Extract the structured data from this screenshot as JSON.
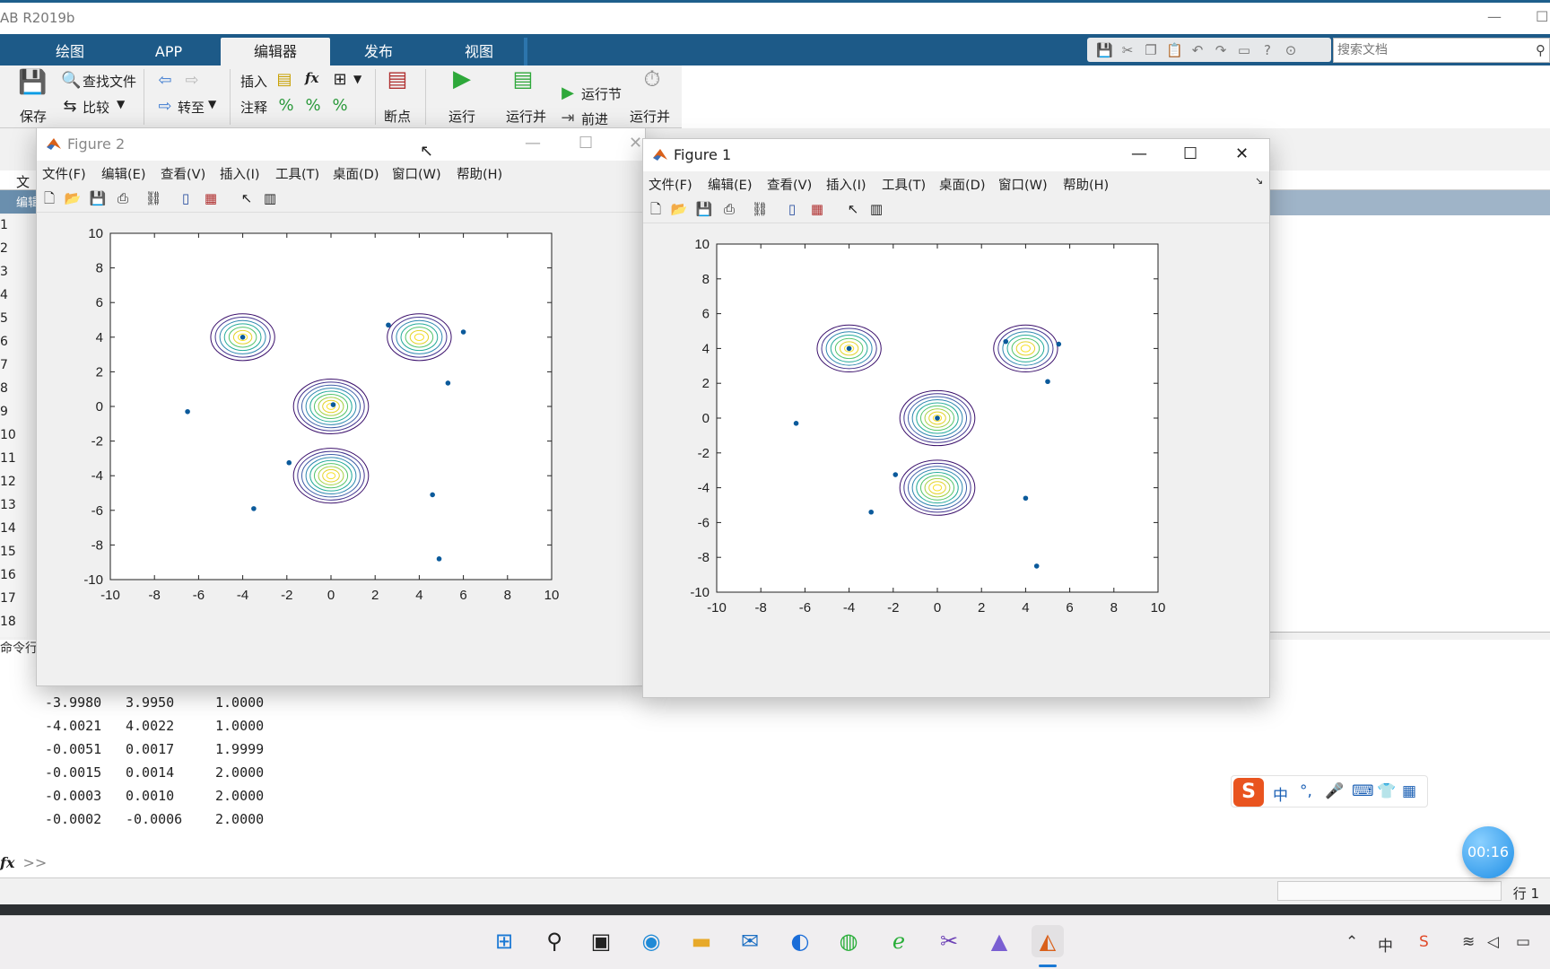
{
  "app": {
    "title": "AB R2019b",
    "ribbon_tabs": [
      "绘图",
      "APP",
      "编辑器",
      "发布",
      "视图"
    ],
    "active_tab": "编辑器",
    "search_placeholder": "搜索文档"
  },
  "toolstrip": {
    "save": "保存",
    "find_files": "查找文件",
    "compare": "比较",
    "goto": "转至",
    "insert": "插入",
    "comment": "注释",
    "fx": "fx",
    "breakpoints": "断点",
    "run": "运行",
    "run_advance": "运行并",
    "run_section": "运行节",
    "advance": "前进",
    "run_time": "运行并",
    "file_section": "文"
  },
  "editor": {
    "tab_label": "编辑",
    "line_numbers": [
      "1",
      "2",
      "3",
      "4",
      "5",
      "6",
      "7",
      "8",
      "9",
      "10",
      "11",
      "12",
      "13",
      "14",
      "15",
      "16",
      "17",
      "18"
    ]
  },
  "command_window": {
    "label": "命令行",
    "rows": [
      [
        "-3.9980",
        "3.9950",
        "1.0000"
      ],
      [
        "-4.0021",
        "4.0022",
        "1.0000"
      ],
      [
        "-0.0051",
        "0.0017",
        "1.9999"
      ],
      [
        "-0.0015",
        "0.0014",
        "2.0000"
      ],
      [
        "-0.0003",
        "0.0010",
        "2.0000"
      ],
      [
        "-0.0002",
        "-0.0006",
        "2.0000"
      ]
    ],
    "prompt": ">>",
    "fx": "fx"
  },
  "status": {
    "line_indicator": "行  1"
  },
  "figure_menu": [
    "文件(F)",
    "编辑(E)",
    "查看(V)",
    "插入(I)",
    "工具(T)",
    "桌面(D)",
    "窗口(W)",
    "帮助(H)"
  ],
  "figures": [
    {
      "title": "Figure 2"
    },
    {
      "title": "Figure 1"
    }
  ],
  "chart_data": [
    {
      "type": "scatter",
      "title": "",
      "xlabel": "",
      "ylabel": "",
      "xlim": [
        -10,
        10
      ],
      "ylim": [
        -10,
        10
      ],
      "xticks": [
        -10,
        -8,
        -6,
        -4,
        -2,
        0,
        2,
        4,
        6,
        8,
        10
      ],
      "yticks": [
        -10,
        -8,
        -6,
        -4,
        -2,
        0,
        2,
        4,
        6,
        8,
        10
      ],
      "contours": [
        {
          "cx": -4,
          "cy": 4,
          "rx": 1.45,
          "ry": 1.45,
          "rings": 7
        },
        {
          "cx": 4,
          "cy": 4,
          "rx": 1.45,
          "ry": 1.45,
          "rings": 7
        },
        {
          "cx": 0,
          "cy": 0,
          "rx": 1.7,
          "ry": 1.7,
          "rings": 9
        },
        {
          "cx": 0,
          "cy": -4,
          "rx": 1.7,
          "ry": 1.7,
          "rings": 9
        }
      ],
      "points": [
        {
          "x": -4.0,
          "y": 4.0
        },
        {
          "x": 0.1,
          "y": 0.1
        },
        {
          "x": -6.5,
          "y": -0.3
        },
        {
          "x": 2.6,
          "y": 4.7
        },
        {
          "x": 6.0,
          "y": 4.3
        },
        {
          "x": 5.3,
          "y": 1.35
        },
        {
          "x": -1.9,
          "y": -3.25
        },
        {
          "x": -3.5,
          "y": -5.9
        },
        {
          "x": 4.6,
          "y": -5.1
        },
        {
          "x": 4.9,
          "y": -8.8
        }
      ]
    },
    {
      "type": "scatter",
      "title": "",
      "xlabel": "",
      "ylabel": "",
      "xlim": [
        -10,
        10
      ],
      "ylim": [
        -10,
        10
      ],
      "xticks": [
        -10,
        -8,
        -6,
        -4,
        -2,
        0,
        2,
        4,
        6,
        8,
        10
      ],
      "yticks": [
        -10,
        -8,
        -6,
        -4,
        -2,
        0,
        2,
        4,
        6,
        8,
        10
      ],
      "contours": [
        {
          "cx": -4,
          "cy": 4,
          "rx": 1.45,
          "ry": 1.45,
          "rings": 7
        },
        {
          "cx": 4,
          "cy": 4,
          "rx": 1.45,
          "ry": 1.45,
          "rings": 7
        },
        {
          "cx": 0,
          "cy": 0,
          "rx": 1.7,
          "ry": 1.7,
          "rings": 9
        },
        {
          "cx": 0,
          "cy": -4,
          "rx": 1.7,
          "ry": 1.7,
          "rings": 9
        }
      ],
      "points": [
        {
          "x": -4.0,
          "y": 4.0
        },
        {
          "x": 0.0,
          "y": 0.0
        },
        {
          "x": -6.4,
          "y": -0.3
        },
        {
          "x": 3.1,
          "y": 4.4
        },
        {
          "x": 5.5,
          "y": 4.25
        },
        {
          "x": 5.0,
          "y": 2.1
        },
        {
          "x": -1.9,
          "y": -3.25
        },
        {
          "x": -3.0,
          "y": -5.4
        },
        {
          "x": 4.0,
          "y": -4.6
        },
        {
          "x": 4.5,
          "y": -8.5
        }
      ]
    }
  ],
  "ime": {
    "logo": "S",
    "items": [
      "中",
      "°,",
      "🎤",
      "⌨",
      "👕",
      "▦"
    ]
  },
  "timer": "00:16",
  "colors": {
    "ribbon": "#1d5a88",
    "marker": "#0b5a9b"
  }
}
